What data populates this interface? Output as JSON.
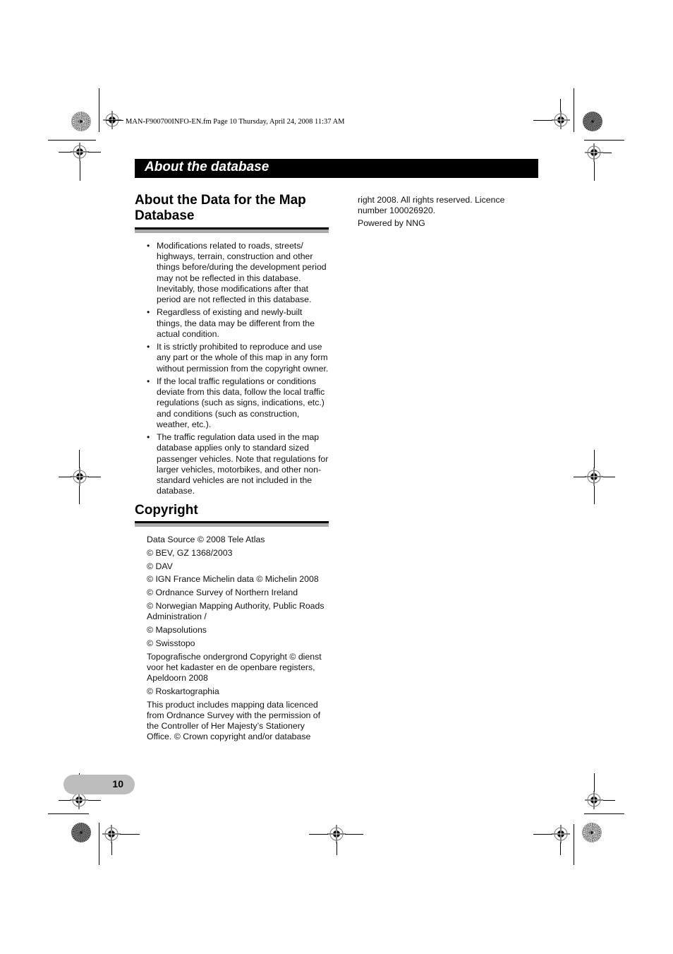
{
  "file_header": "MAN-F900700INFO-EN.fm  Page 10  Thursday, April 24, 2008  11:37 AM",
  "section_banner": "About the database",
  "sections": {
    "map_data": {
      "heading": "About the Data for the Map Database",
      "bullet_glyph": "•",
      "bullets": [
        "Modifications related to roads, streets/ highways, terrain, construction and other things before/during the development period may not be reflected in this database. Inevitably, those modifications after that period are not reflected in this database.",
        "Regardless of existing and newly-built things, the data may be different from the actual condition.",
        "It is strictly prohibited to reproduce and use any part or the whole of this map in any form without permission from the copyright owner.",
        "If the local traffic regulations or conditions deviate from this data, follow the local traffic regulations (such as signs, indications, etc.) and conditions (such as construction, weather, etc.).",
        "The traffic regulation data used in the map database applies only to standard sized passenger vehicles. Note that regulations for larger vehicles, motorbikes, and other non-standard vehicles are not included in the database."
      ]
    },
    "copyright": {
      "heading": "Copyright",
      "lines": [
        "Data Source © 2008 Tele Atlas",
        "© BEV, GZ 1368/2003",
        "© DAV",
        "© IGN France Michelin data © Michelin 2008",
        "© Ordnance Survey of Northern Ireland",
        "© Norwegian Mapping Authority, Public Roads Administration /",
        "© Mapsolutions",
        "© Swisstopo",
        "Topografische ondergrond Copyright © dienst voor het kadaster en de openbare registers, Apeldoorn 2008",
        "© Roskartographia",
        "This product includes mapping data licenced from Ordnance Survey with the permission of the Controller of Her Majesty’s Stationery Office. © Crown copyright and/or database"
      ],
      "continued": [
        "right 2008. All rights reserved. Licence number 100026920.",
        "Powered by NNG"
      ]
    }
  },
  "page_number": "10",
  "marks": {
    "registration": "registration-mark",
    "rosette": "color-rosette"
  }
}
